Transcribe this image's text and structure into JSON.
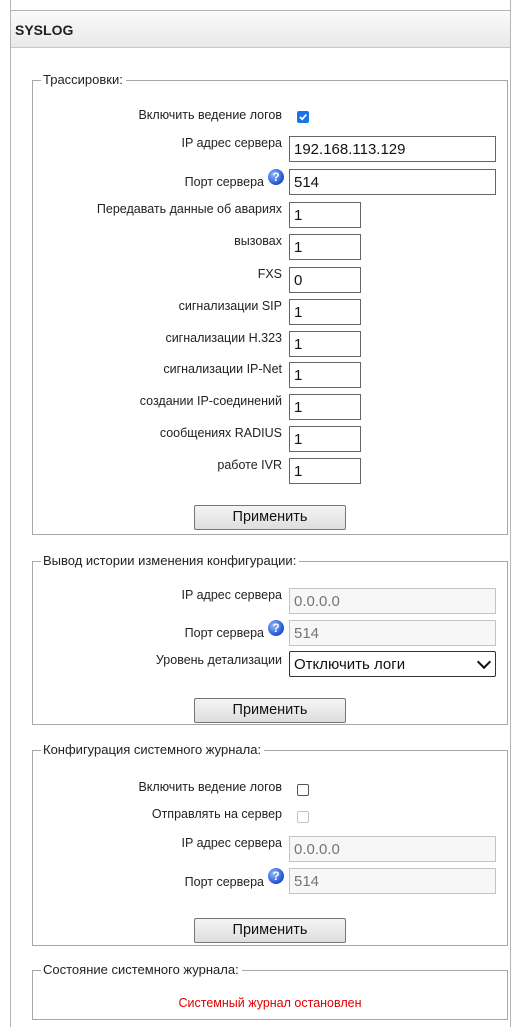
{
  "header": {
    "title": "SYSLOG"
  },
  "tracing": {
    "legend": "Трассировки:",
    "enable_label": "Включить ведение логов",
    "enable_checked": true,
    "server_ip_label": "IP адрес сервера",
    "server_ip": "192.168.113.129",
    "server_port_label": "Порт сервера",
    "server_port": "514",
    "alarms_label": "Передавать данные об авариях",
    "alarms": "1",
    "calls_label": "вызовах",
    "calls": "1",
    "fxs_label": "FXS",
    "fxs": "0",
    "sip_label": "сигнализации SIP",
    "sip": "1",
    "h323_label": "сигнализации H.323",
    "h323": "1",
    "ipnet_label": "сигнализации IP-Net",
    "ipnet": "1",
    "ipconn_label": "создании IP-соединений",
    "ipconn": "1",
    "radius_label": "сообщениях RADIUS",
    "radius": "1",
    "ivr_label": "работе IVR",
    "ivr": "1",
    "apply_label": "Применить"
  },
  "config_history": {
    "legend": "Вывод истории изменения конфигурации:",
    "server_ip_label": "IP адрес сервера",
    "server_ip": "0.0.0.0",
    "server_port_label": "Порт сервера",
    "server_port": "514",
    "detail_label": "Уровень детализации",
    "detail_value": "Отключить логи",
    "apply_label": "Применить"
  },
  "system_log": {
    "legend": "Конфигурация системного журнала:",
    "enable_label": "Включить ведение логов",
    "enable_checked": false,
    "send_label": "Отправлять на сервер",
    "send_checked": false,
    "server_ip_label": "IP адрес сервера",
    "server_ip": "0.0.0.0",
    "server_port_label": "Порт сервера",
    "server_port": "514",
    "apply_label": "Применить"
  },
  "log_state": {
    "legend": "Состояние системного журнала:",
    "status": "Системный журнал остановлен",
    "status_color": "#e00000"
  },
  "icons": {
    "help": "question-icon"
  },
  "colors": {
    "checkbox_accent": "#1a73e8",
    "help_icon": "#1f4fd1"
  }
}
